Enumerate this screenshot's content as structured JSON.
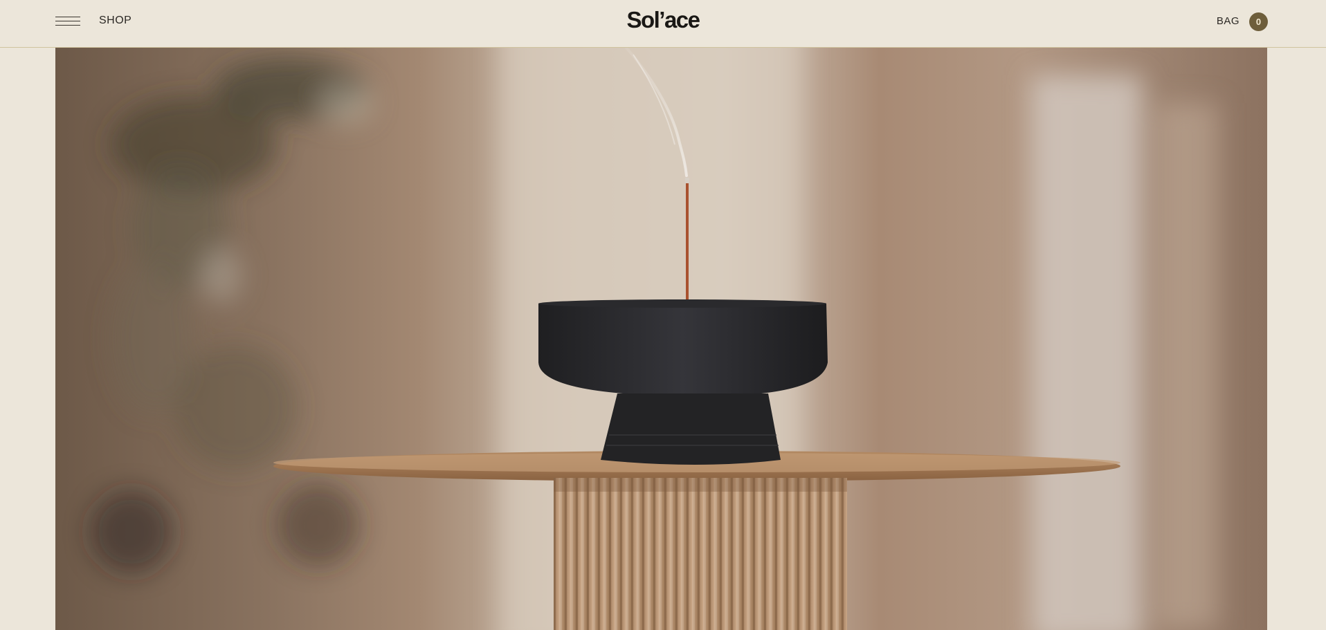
{
  "header": {
    "shop_label": "SHOP",
    "logo_text": "Sol’ace",
    "bag_label": "BAG",
    "bag_count": "0",
    "menu_icon": "hamburger-menu-icon"
  },
  "hero": {
    "image_subject": "incense-holder-on-table"
  },
  "colors": {
    "background": "#ece6da",
    "header_border": "#cfc39e",
    "bag_badge": "#6e5e3b",
    "logo": "#1a1815"
  }
}
